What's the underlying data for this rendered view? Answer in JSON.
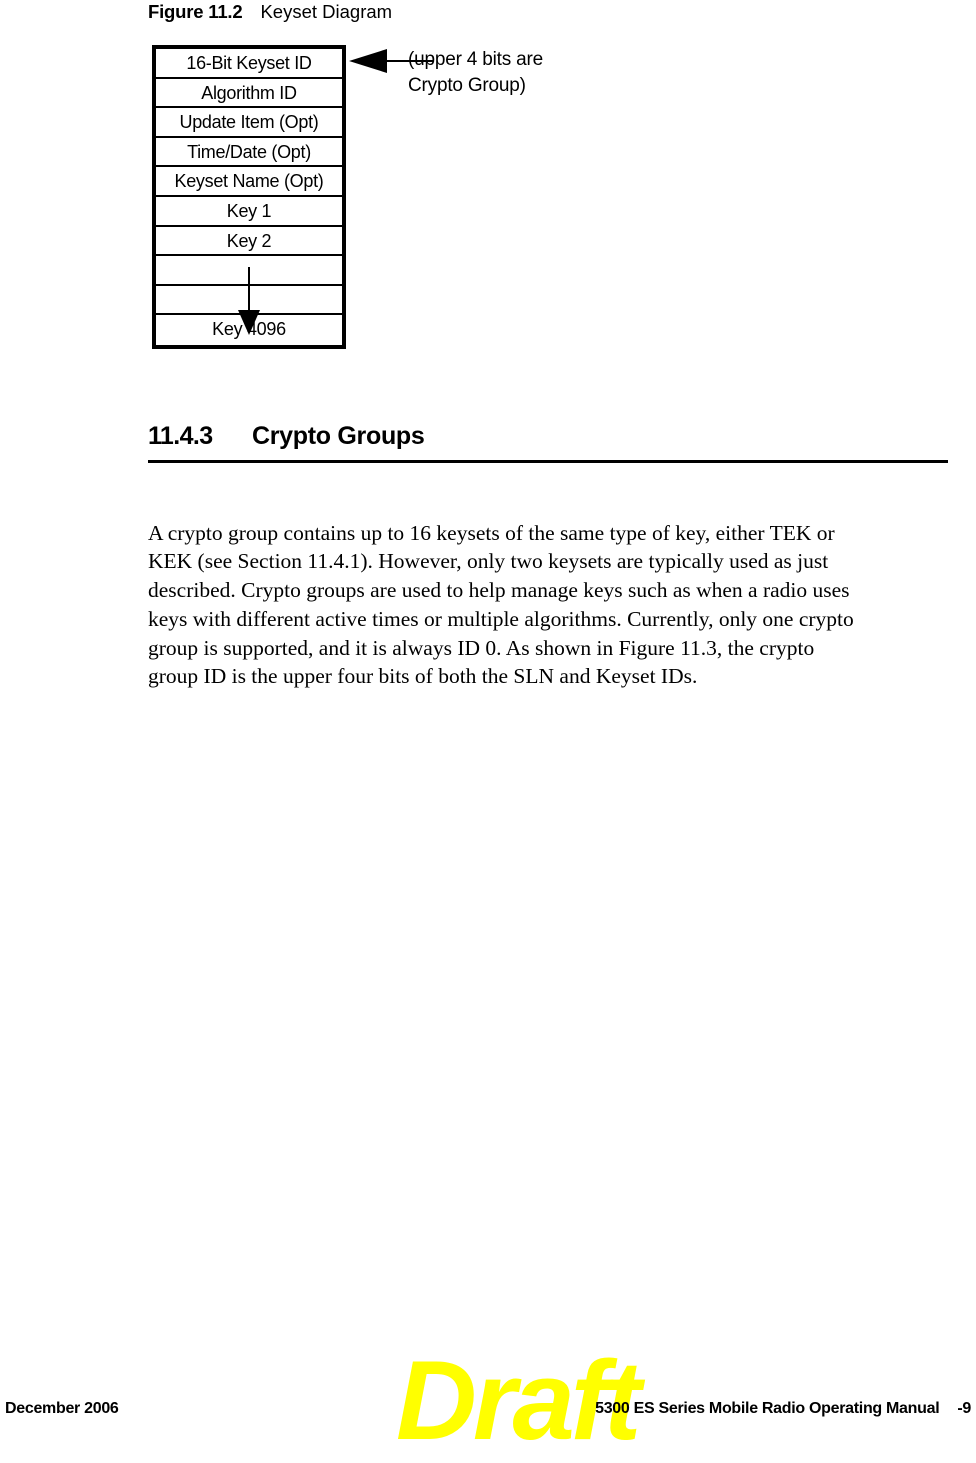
{
  "figure": {
    "label": "Figure 11.2",
    "title": "Keyset Diagram"
  },
  "diagram": {
    "name": "keyset-diagram",
    "rows": [
      "16-Bit Keyset ID",
      "Algorithm ID",
      "Update Item (Opt)",
      "Time/Date (Opt)",
      "Keyset Name (Opt)",
      "Key 1",
      "Key 2",
      "",
      "",
      "Key 4096"
    ],
    "callout": {
      "line1": "(upper 4 bits are",
      "line2": "Crypto Group)"
    }
  },
  "section": {
    "number": "11.4.3",
    "title": "Crypto Groups"
  },
  "body": {
    "paragraph": "A crypto group contains up to 16 keysets of the same type of key, either TEK or KEK (see Section 11.4.1). However, only two keysets are typically used as just described. Crypto groups are used to help manage keys such as when a radio uses keys with different active times or multiple algorithms. Currently, only one crypto group is supported, and it is always ID 0. As shown in Figure 11.3, the crypto group ID is the upper four bits of both the SLN and Keyset IDs."
  },
  "footer": {
    "date": "December 2006",
    "manual_title": "5300 ES Series Mobile Radio Operating Manual",
    "page_number": "-9",
    "watermark": "Draft",
    "watermark_color": "#ffff00"
  }
}
